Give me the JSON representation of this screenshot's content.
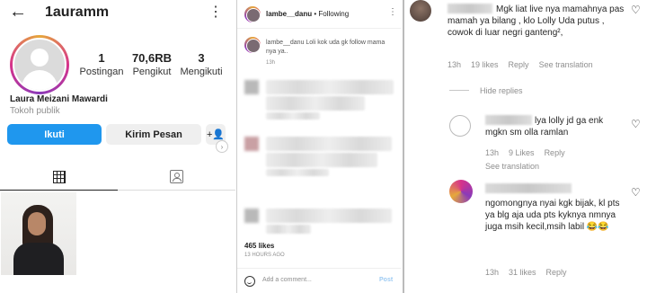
{
  "profile": {
    "back_glyph": "←",
    "username": "1auramm",
    "more_glyph": "⋮",
    "stats": [
      {
        "value": "1",
        "label": "Postingan"
      },
      {
        "value": "70,6RB",
        "label": "Pengikut"
      },
      {
        "value": "3",
        "label": "Mengikuti"
      }
    ],
    "full_name": "Laura Meizani Mawardi",
    "category": "Tokoh publik",
    "follow_label": "Ikuti",
    "message_label": "Kirim Pesan",
    "add_friend_glyph": "+👤",
    "next_glyph": "›"
  },
  "post": {
    "username": "lambe__danu",
    "following": "• Following",
    "more_glyph": "⋮",
    "caption_user": "lambe__danu",
    "caption": "Loli kok uda gk follow mama nya ya..",
    "time": "13h",
    "likes": "465 likes",
    "ago": "13 HOURS AGO",
    "comment_placeholder": "Add a comment...",
    "post_label": "Post"
  },
  "comments": [
    {
      "text": "Mgk liat live nya mamahnya pas mamah ya bilang , klo Lolly Uda putus , cowok di luar negri ganteng²,",
      "time": "13h",
      "likes": "19 likes",
      "reply": "Reply",
      "translate": "See translation"
    },
    {
      "text": "lya lolly jd ga enk mgkn sm olla ramlan",
      "time": "13h",
      "likes": "9 Likes",
      "reply": "Reply",
      "translate": "See translation"
    },
    {
      "text": "ngomongnya nyai kgk bijak, kl pts ya blg aja uda pts kyknya nmnya juga msih kecil,msih labil 😂😂",
      "time": "13h",
      "likes": "31 likes",
      "reply": "Reply"
    }
  ],
  "hide_replies": "Hide replies",
  "heart_glyph": "♡"
}
